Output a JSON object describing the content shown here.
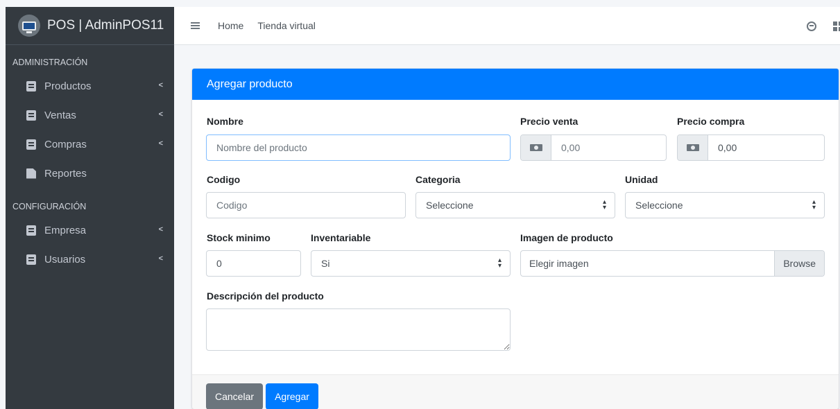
{
  "app": {
    "brand": "POS | AdminPOS11"
  },
  "topbar": {
    "links": [
      "Home",
      "Tienda virtual"
    ]
  },
  "sidebar": {
    "section1": "ADMINISTRACIÓN",
    "section2": "CONFIGURACIÓN",
    "items": [
      "Productos",
      "Ventas",
      "Compras",
      "Reportes",
      "Empresa",
      "Usuarios"
    ],
    "chevron": "<"
  },
  "card": {
    "title": "Agregar producto"
  },
  "form": {
    "nombre": {
      "label": "Nombre",
      "placeholder": "Nombre del producto"
    },
    "precio_venta": {
      "label": "Precio venta",
      "value": "0,00"
    },
    "precio_compra": {
      "label": "Precio compra",
      "value": "0,00"
    },
    "codigo": {
      "label": "Codigo",
      "placeholder": "Codigo"
    },
    "categoria": {
      "label": "Categoria",
      "value": "Seleccione"
    },
    "unidad": {
      "label": "Unidad",
      "value": "Seleccione"
    },
    "stock_minimo": {
      "label": "Stock minimo",
      "value": "0"
    },
    "inventariable": {
      "label": "Inventariable",
      "value": "Si"
    },
    "imagen": {
      "label": "Imagen de producto",
      "value": "Elegir imagen",
      "browse": "Browse"
    },
    "descripcion": {
      "label": "Descripción del producto"
    }
  },
  "buttons": {
    "cancel": "Cancelar",
    "add": "Agregar"
  },
  "colors": {
    "primary": "#007bff",
    "sidebar": "#343a40",
    "secondary": "#6c757d"
  }
}
